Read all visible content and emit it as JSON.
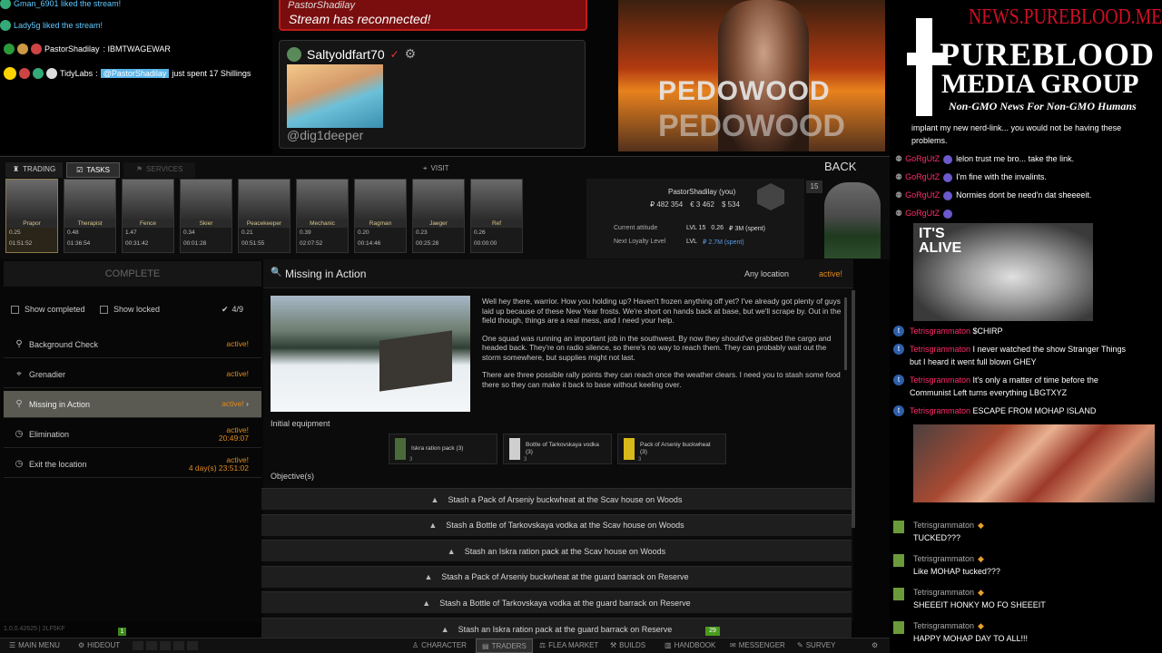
{
  "stream_events": [
    {
      "text": "Gman_6901 liked the stream!"
    },
    {
      "text": "Lady5g liked the stream!"
    },
    {
      "user": "PastorShadilay",
      "message": ": IBMTWAGEWAR"
    },
    {
      "user": "TidyLabs",
      "mention": "@PastorShadilay",
      "message": "just spent 17 Shillings"
    }
  ],
  "banner": {
    "user": "PastorShadilay",
    "text": "Stream has reconnected!"
  },
  "saltycard": {
    "name": "Saltyoldfart70",
    "handle": "@dig1deeper"
  },
  "webcam": {
    "overlay_text": "PEDOWOOD",
    "overlay_text2": "PEDOWOOD"
  },
  "logo": {
    "site": "NEWS.PUREBLOOD.MEDIA",
    "line1": "PUREBLOOD",
    "line2": "MEDIA GROUP",
    "tagline": "Non-GMO News For Non-GMO Humans"
  },
  "game": {
    "tabs": {
      "trading": "TRADING",
      "tasks": "TASKS",
      "services": "SERVICES",
      "visit": "VISIT",
      "back": "BACK"
    },
    "traders": [
      {
        "name": "Prapor",
        "rep": "0.25",
        "time": "01:51:52",
        "selected": true
      },
      {
        "name": "Therapist",
        "rep": "0.48",
        "time": "01:36:54"
      },
      {
        "name": "Fence",
        "rep": "1.47",
        "time": "00:31:42"
      },
      {
        "name": "Skier",
        "rep": "0.34",
        "time": "00:01:28"
      },
      {
        "name": "Peacekeeper",
        "rep": "0.21",
        "time": "00:51:55"
      },
      {
        "name": "Mechanic",
        "rep": "0.39",
        "time": "02:07:52"
      },
      {
        "name": "Ragman",
        "rep": "0.20",
        "time": "00:14:46"
      },
      {
        "name": "Jaeger",
        "rep": "0.23",
        "time": "00:25:28"
      },
      {
        "name": "Ref",
        "rep": "0.26",
        "time": "00:00:00"
      }
    ],
    "player": {
      "name": "PastorShadilay (you)",
      "roubles": "₽ 482 354",
      "euros": "€ 3 462",
      "dollars": "$ 534",
      "level": "15",
      "current_attitude_label": "Current attitude",
      "next_loyalty_label": "Next Loyalty Level",
      "lvl1": "LVL 15",
      "val1": "0.26",
      "spent1": "₽ 3M (spent)",
      "lvl2": "LVL",
      "spent2": "₽ 2.7M (spent)"
    },
    "complete_label": "COMPLETE",
    "filters": {
      "show_completed": "Show completed",
      "show_locked": "Show locked",
      "count": "4/9"
    },
    "tasks": [
      {
        "name": "Background Check",
        "status": "active!",
        "icon": "magnifier-icon"
      },
      {
        "name": "Grenadier",
        "status": "active!",
        "icon": "target-icon"
      },
      {
        "name": "Missing in Action",
        "status": "active!",
        "icon": "magnifier-icon",
        "selected": true
      },
      {
        "name": "Elimination",
        "status": "active!",
        "timer": "20:49:07",
        "icon": "clock-icon"
      },
      {
        "name": "Exit the location",
        "status": "active!",
        "timer": "4 day(s) 23:51:02",
        "icon": "clock-icon"
      }
    ],
    "detail": {
      "title": "Missing in Action",
      "location": "Any location",
      "status": "active!",
      "para1": "Well hey there, warrior. How you holding up? Haven't frozen anything off yet? I've already got plenty of guys laid up because of these New Year frosts. We're short on hands back at base, but we'll scrape by. Out in the field though, things are a real mess, and I need your help.",
      "para2": "One squad was running an important job in the southwest. By now they should've grabbed the cargo and headed back. They're on radio silence, so there's no way to reach them. They can probably wait out the storm somewhere, but supplies might not last.",
      "para3": "There are three possible rally points they can reach once the weather clears. I need you to stash some food there so they can make it back to base without keeling over.",
      "initial_equipment_label": "Initial equipment",
      "equipment": [
        {
          "name": "Iskra ration pack (3)",
          "qty": "3"
        },
        {
          "name": "Bottle of Tarkovskaya vodka (3)",
          "qty": "3"
        },
        {
          "name": "Pack of Arseniy buckwheat (3)",
          "qty": "3"
        }
      ],
      "objectives_label": "Objective(s)",
      "objectives": [
        "Stash a Pack of Arseniy buckwheat at the Scav house on Woods",
        "Stash a Bottle of Tarkovskaya vodka at the Scav house on Woods",
        "Stash an Iskra ration pack at the Scav house on Woods",
        "Stash a Pack of Arseniy buckwheat at the guard barrack on Reserve",
        "Stash a Bottle of Tarkovskaya vodka at the guard barrack on Reserve",
        "Stash an Iskra ration pack at the guard barrack on Reserve"
      ]
    },
    "version": "1.0.0.42625 | 2LF5KF",
    "bottom_badge1": "1",
    "bottom_badge2": "29",
    "bottom_nav": {
      "main_menu": "MAIN MENU",
      "hideout": "HIDEOUT",
      "character": "CHARACTER",
      "traders": "TRADERS",
      "flea": "FLEA MARKET",
      "builds": "BUILDS",
      "handbook": "HANDBOOK",
      "messenger": "MESSENGER",
      "survey": "SURVEY"
    }
  },
  "chat_top": [
    {
      "user": "",
      "text": "implant my new nerd-link... you would not be having these problems."
    },
    {
      "user": "GoRgUtZ",
      "text": "lelon trust me bro... take the link."
    },
    {
      "user": "GoRgUtZ",
      "text": "I'm fine with the invalints."
    },
    {
      "user": "GoRgUtZ",
      "text": "Normies dont be need'n dat sheeeeit."
    },
    {
      "user": "GoRgUtZ",
      "text": ""
    }
  ],
  "meme_text": "IT'S ALIVE",
  "chat_mid": [
    {
      "user": "Tetrisgrammaton",
      "text": "$CHIRP"
    },
    {
      "user": "Tetrisgrammaton",
      "text": "I never watched the show Stranger Things but I heard it went full blown GHEY"
    },
    {
      "user": "Tetrisgrammaton",
      "text": "It's only a matter of time before the Communist Left turns everything LBGTXYZ"
    },
    {
      "user": "Tetrisgrammaton",
      "text": "ESCAPE FROM MOHAP ISLAND"
    }
  ],
  "chat_bottom": [
    {
      "user": "Tetrisgrammaton",
      "text": "TUCKED???"
    },
    {
      "user": "Tetrisgrammaton",
      "text": "Like MOHAP tucked???"
    },
    {
      "user": "Tetrisgrammaton",
      "text": "SHEEEIT HONKY MO FO SHEEEIT"
    },
    {
      "user": "Tetrisgrammaton",
      "text": "HAPPY MOHAP DAY TO ALL!!!"
    }
  ]
}
